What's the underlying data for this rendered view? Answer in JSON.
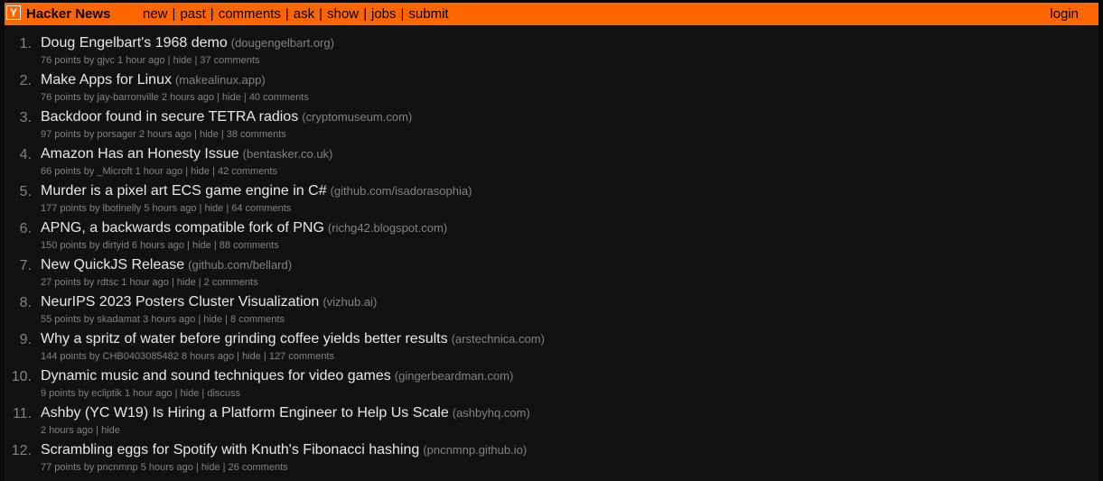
{
  "header": {
    "logo_letter": "Y",
    "site_name": "Hacker News",
    "nav": [
      "new",
      "past",
      "comments",
      "ask",
      "show",
      "jobs",
      "submit"
    ],
    "login": "login"
  },
  "colors": {
    "accent": "#ff6600",
    "background": "#121210",
    "title_text": "#e8e8e8",
    "subtext": "#828282"
  },
  "stories": [
    {
      "rank": "1.",
      "title": "Doug Engelbart's 1968 demo",
      "domain": "(dougengelbart.org)",
      "points": "76 points",
      "user": "gjvc",
      "age": "1 hour ago",
      "hide": "hide",
      "comments": "37 comments"
    },
    {
      "rank": "2.",
      "title": "Make Apps for Linux",
      "domain": "(makealinux.app)",
      "points": "76 points",
      "user": "jay-barronville",
      "age": "2 hours ago",
      "hide": "hide",
      "comments": "40 comments"
    },
    {
      "rank": "3.",
      "title": "Backdoor found in secure TETRA radios",
      "domain": "(cryptomuseum.com)",
      "points": "97 points",
      "user": "porsager",
      "age": "2 hours ago",
      "hide": "hide",
      "comments": "38 comments"
    },
    {
      "rank": "4.",
      "title": "Amazon Has an Honesty Issue",
      "domain": "(bentasker.co.uk)",
      "points": "66 points",
      "user": "_Microft",
      "age": "1 hour ago",
      "hide": "hide",
      "comments": "42 comments"
    },
    {
      "rank": "5.",
      "title": "Murder is a pixel art ECS game engine in C#",
      "domain": "(github.com/isadorasophia)",
      "points": "177 points",
      "user": "lbotinelly",
      "age": "5 hours ago",
      "hide": "hide",
      "comments": "64 comments"
    },
    {
      "rank": "6.",
      "title": "APNG, a backwards compatible fork of PNG",
      "domain": "(richg42.blogspot.com)",
      "points": "150 points",
      "user": "dirtyid",
      "age": "6 hours ago",
      "hide": "hide",
      "comments": "88 comments"
    },
    {
      "rank": "7.",
      "title": "New QuickJS Release",
      "domain": "(github.com/bellard)",
      "points": "27 points",
      "user": "rdtsc",
      "age": "1 hour ago",
      "hide": "hide",
      "comments": "2 comments"
    },
    {
      "rank": "8.",
      "title": "NeurIPS 2023 Posters Cluster Visualization",
      "domain": "(vizhub.ai)",
      "points": "55 points",
      "user": "skadamat",
      "age": "3 hours ago",
      "hide": "hide",
      "comments": "8 comments"
    },
    {
      "rank": "9.",
      "title": "Why a spritz of water before grinding coffee yields better results",
      "domain": "(arstechnica.com)",
      "points": "144 points",
      "user": "CHB0403085482",
      "age": "8 hours ago",
      "hide": "hide",
      "comments": "127 comments"
    },
    {
      "rank": "10.",
      "title": "Dynamic music and sound techniques for video games",
      "domain": "(gingerbeardman.com)",
      "points": "9 points",
      "user": "ecliptik",
      "age": "1 hour ago",
      "hide": "hide",
      "comments": "discuss"
    },
    {
      "rank": "11.",
      "title": "Ashby (YC W19) Is Hiring a Platform Engineer to Help Us Scale",
      "domain": "(ashbyhq.com)",
      "points": "",
      "user": "",
      "age": "2 hours ago",
      "hide": "hide",
      "comments": ""
    },
    {
      "rank": "12.",
      "title": "Scrambling eggs for Spotify with Knuth's Fibonacci hashing",
      "domain": "(pncnmnp.github.io)",
      "points": "77 points",
      "user": "pncnmnp",
      "age": "5 hours ago",
      "hide": "hide",
      "comments": "26 comments"
    }
  ]
}
